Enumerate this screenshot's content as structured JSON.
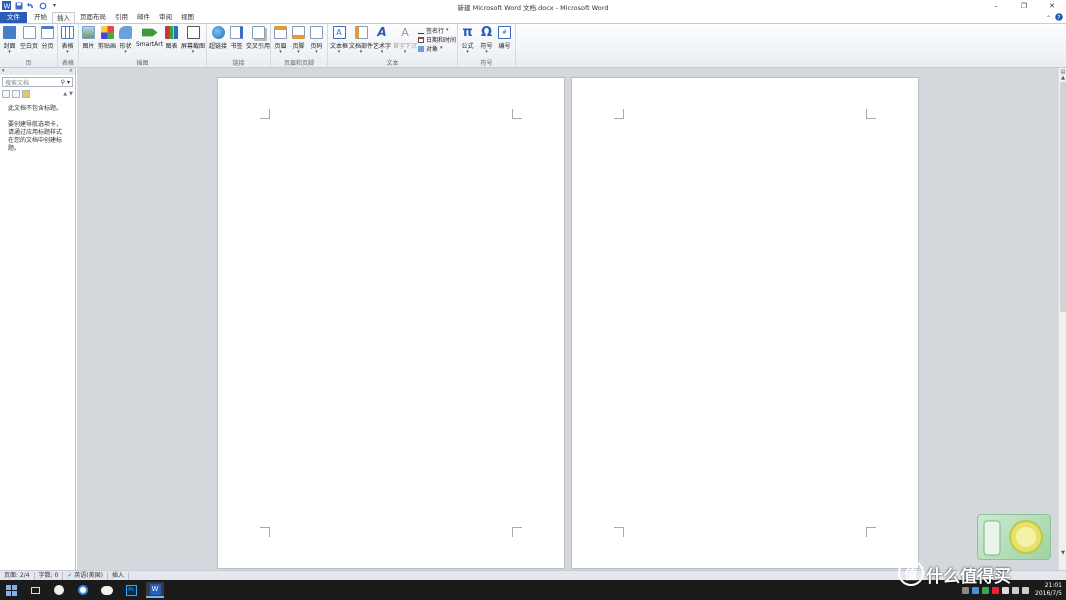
{
  "window": {
    "title": "新建 Microsoft Word 文档.docx - Microsoft Word"
  },
  "tabs": [
    "文件",
    "开始",
    "插入",
    "页面布局",
    "引用",
    "邮件",
    "审阅",
    "视图"
  ],
  "active_tab": "插入",
  "ribbon": {
    "groups": {
      "pages": "页",
      "tables": "表格",
      "illustrations": "插图",
      "links": "链接",
      "header_footer": "页眉和页脚",
      "text": "文本",
      "symbols": "符号"
    },
    "buttons": {
      "cover": "封面",
      "blank": "空白页",
      "break": "分页",
      "table": "表格",
      "picture": "图片",
      "clipart": "剪贴画",
      "shapes": "形状",
      "smartart": "SmartArt",
      "chart": "图表",
      "screenshot": "屏幕截图",
      "hyperlink": "超链接",
      "bookmark": "书签",
      "crossref": "交叉引用",
      "header": "页眉",
      "footer": "页脚",
      "pagenum": "页码",
      "textbox": "文本框",
      "quickparts": "文档部件",
      "wordart": "艺术字",
      "dropcap": "首字下沉",
      "sigline": "签名行",
      "datetime": "日期和时间",
      "object": "对象",
      "equation": "公式",
      "symbol": "符号",
      "number": "编号"
    }
  },
  "nav": {
    "search_placeholder": "搜索文档",
    "message1": "此文档不包含标题。",
    "message2": "要创建导航选项卡，请通过应用标题样式在您的文档中创建标题。"
  },
  "status": {
    "page": "页面: 2/4",
    "words": "字数: 0",
    "language": "英语(美国)",
    "mode": "插入"
  },
  "clock": {
    "time": "21:01",
    "date": "2016/7/5"
  },
  "watermark": {
    "text": "什么值得买",
    "logo": "值"
  }
}
